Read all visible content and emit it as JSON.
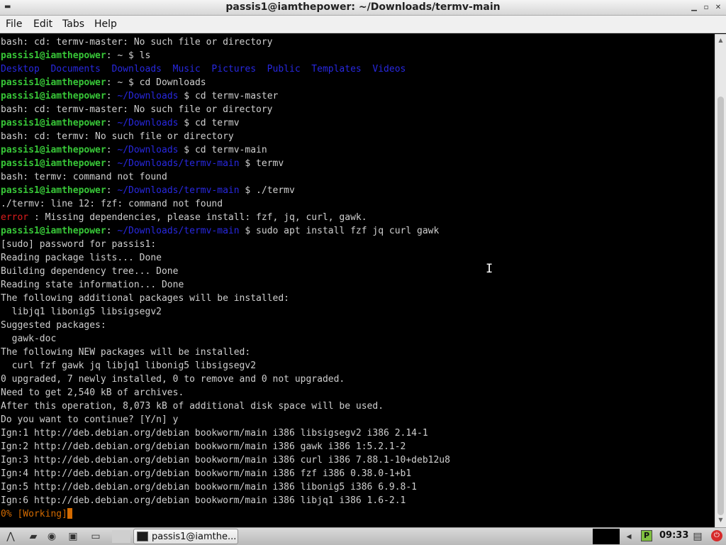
{
  "window": {
    "title": "passis1@iamthepower: ~/Downloads/termv-main"
  },
  "menu": {
    "file": "File",
    "edit": "Edit",
    "tabs": "Tabs",
    "help": "Help"
  },
  "colors": {
    "green": "#38c838",
    "blue": "#2828e0",
    "red": "#dd1d1d",
    "text": "#cfcfcf",
    "cursor": "#d36a00"
  },
  "terminal": {
    "lines": [
      [
        {
          "t": "bash: cd: termv-master: No such file or directory"
        }
      ],
      [
        {
          "t": "passis1@iamthepower",
          "c": "g"
        },
        {
          "t": ": ~ $ ls"
        }
      ],
      [
        {
          "t": "Desktop  Documents  Downloads  Music  Pictures  Public  Templates  Videos",
          "c": "b"
        }
      ],
      [
        {
          "t": "passis1@iamthepower",
          "c": "g"
        },
        {
          "t": ": ~ $ cd Downloads"
        }
      ],
      [
        {
          "t": "passis1@iamthepower",
          "c": "g"
        },
        {
          "t": ": "
        },
        {
          "t": "~/Downloads",
          "c": "b"
        },
        {
          "t": " $ cd termv-master"
        }
      ],
      [
        {
          "t": "bash: cd: termv-master: No such file or directory"
        }
      ],
      [
        {
          "t": "passis1@iamthepower",
          "c": "g"
        },
        {
          "t": ": "
        },
        {
          "t": "~/Downloads",
          "c": "b"
        },
        {
          "t": " $ cd termv"
        }
      ],
      [
        {
          "t": "bash: cd: termv: No such file or directory"
        }
      ],
      [
        {
          "t": "passis1@iamthepower",
          "c": "g"
        },
        {
          "t": ": "
        },
        {
          "t": "~/Downloads",
          "c": "b"
        },
        {
          "t": " $ cd termv-main"
        }
      ],
      [
        {
          "t": "passis1@iamthepower",
          "c": "g"
        },
        {
          "t": ": "
        },
        {
          "t": "~/Downloads/termv-main",
          "c": "b"
        },
        {
          "t": " $ termv"
        }
      ],
      [
        {
          "t": "bash: termv: command not found"
        }
      ],
      [
        {
          "t": "passis1@iamthepower",
          "c": "g"
        },
        {
          "t": ": "
        },
        {
          "t": "~/Downloads/termv-main",
          "c": "b"
        },
        {
          "t": " $ ./termv"
        }
      ],
      [
        {
          "t": "./termv: line 12: fzf: command not found"
        }
      ],
      [
        {
          "t": "error",
          "c": "r"
        },
        {
          "t": " : Missing dependencies, please install: fzf, jq, curl, gawk."
        }
      ],
      [
        {
          "t": "passis1@iamthepower",
          "c": "g"
        },
        {
          "t": ": "
        },
        {
          "t": "~/Downloads/termv-main",
          "c": "b"
        },
        {
          "t": " $ sudo apt install fzf jq curl gawk"
        }
      ],
      [
        {
          "t": "[sudo] password for passis1:"
        }
      ],
      [
        {
          "t": "Reading package lists... Done"
        }
      ],
      [
        {
          "t": "Building dependency tree... Done"
        }
      ],
      [
        {
          "t": "Reading state information... Done"
        }
      ],
      [
        {
          "t": "The following additional packages will be installed:"
        }
      ],
      [
        {
          "t": "  libjq1 libonig5 libsigsegv2"
        }
      ],
      [
        {
          "t": "Suggested packages:"
        }
      ],
      [
        {
          "t": "  gawk-doc"
        }
      ],
      [
        {
          "t": "The following NEW packages will be installed:"
        }
      ],
      [
        {
          "t": "  curl fzf gawk jq libjq1 libonig5 libsigsegv2"
        }
      ],
      [
        {
          "t": "0 upgraded, 7 newly installed, 0 to remove and 0 not upgraded."
        }
      ],
      [
        {
          "t": "Need to get 2,540 kB of archives."
        }
      ],
      [
        {
          "t": "After this operation, 8,073 kB of additional disk space will be used."
        }
      ],
      [
        {
          "t": "Do you want to continue? [Y/n] y"
        }
      ],
      [
        {
          "t": "Ign:1 http://deb.debian.org/debian bookworm/main i386 libsigsegv2 i386 2.14-1"
        }
      ],
      [
        {
          "t": "Ign:2 http://deb.debian.org/debian bookworm/main i386 gawk i386 1:5.2.1-2"
        }
      ],
      [
        {
          "t": "Ign:3 http://deb.debian.org/debian bookworm/main i386 curl i386 7.88.1-10+deb12u8"
        }
      ],
      [
        {
          "t": "Ign:4 http://deb.debian.org/debian bookworm/main i386 fzf i386 0.38.0-1+b1"
        }
      ],
      [
        {
          "t": "Ign:5 http://deb.debian.org/debian bookworm/main i386 libonig5 i386 6.9.8-1"
        }
      ],
      [
        {
          "t": "Ign:6 http://deb.debian.org/debian bookworm/main i386 libjq1 i386 1.6-2.1"
        }
      ],
      [
        {
          "t": "0% [Working]",
          "c": "w"
        },
        {
          "cursor": true
        }
      ]
    ]
  },
  "taskbar": {
    "task_label": "passis1@iamthe...",
    "clock": "09:33",
    "pager_label": "P"
  }
}
